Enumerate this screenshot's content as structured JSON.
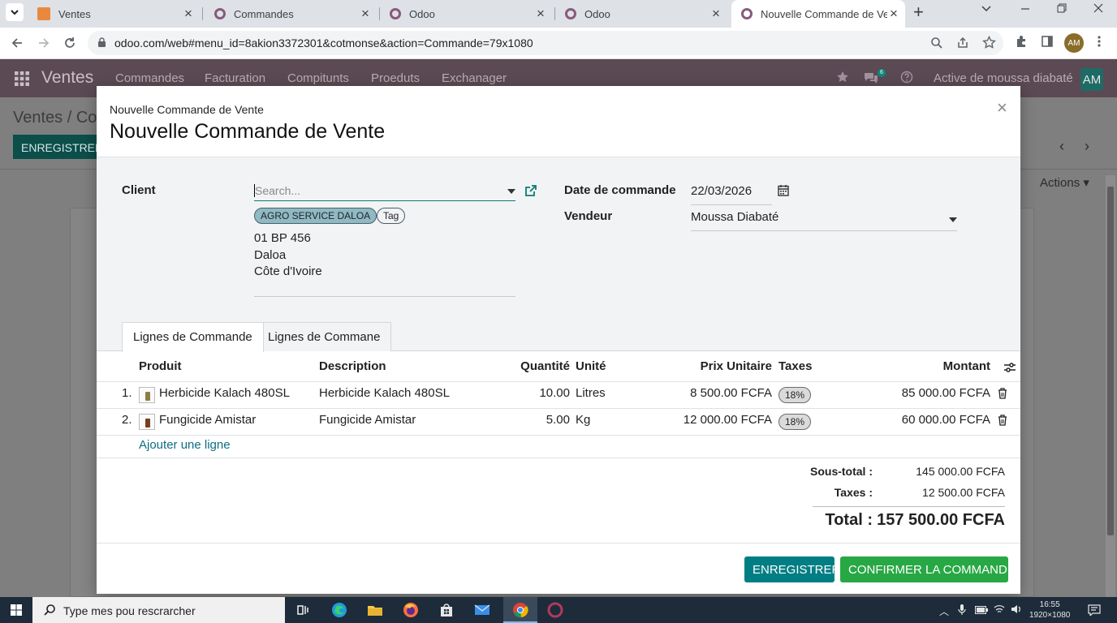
{
  "browser": {
    "tabs": [
      {
        "label": "Ventes",
        "icon": "ventes-favicon"
      },
      {
        "label": "Commandes",
        "icon": "odoo-favicon"
      },
      {
        "label": "Odoo",
        "icon": "odoo-favicon"
      },
      {
        "label": "Odoo",
        "icon": "odoo-favicon"
      },
      {
        "label": "Nouvelle Commande de Vente",
        "icon": "odoo-favicon",
        "active": true
      }
    ],
    "url": "odoo.com/web#menu_id=8akion3372301&cotmonse&action=Commande=79x1080",
    "profile_initials": "AM"
  },
  "navbar": {
    "app": "Ventes",
    "menus": [
      "Commandes",
      "Facturation",
      "Compitunts",
      "Proeduts",
      "Exchanager"
    ],
    "chat_count": "6",
    "company": "Active de moussa diabaté",
    "avatar": "AM"
  },
  "background_page": {
    "breadcrumb": "Ventes / Co",
    "save_label": "ENREGISTRER",
    "actions_label": "Actions"
  },
  "modal": {
    "subtitle": "Nouvelle Commande de Vente",
    "title": "Nouvelle Commande de Vente",
    "close": "×",
    "client": {
      "label": "Client",
      "placeholder": "Search...",
      "tags": [
        "AGRO SERVICE DALOA",
        "Tag"
      ],
      "address": [
        "01 BP 456",
        "Daloa",
        "Côte d'Ivoire"
      ]
    },
    "order_date": {
      "label": "Date de commande",
      "value": "22/03/2026"
    },
    "salesperson": {
      "label": "Vendeur",
      "value": "Moussa Diabaté"
    },
    "tabs": [
      "Lignes de Commande",
      "Lignes de Commane"
    ],
    "columns": {
      "product": "Produit",
      "description": "Description",
      "quantity": "Quantité",
      "unit": "Unité",
      "unit_price": "Prix Unitaire",
      "taxes": "Taxes",
      "amount": "Montant"
    },
    "lines": [
      {
        "num": "1.",
        "product": "Herbicide Kalach 480SL",
        "description": "Herbicide Kalach 480SL",
        "quantity": "10.00",
        "unit": "Litres",
        "unit_price": "8 500.00 FCFA",
        "tax": "18%",
        "amount": "85 000.00 FCFA"
      },
      {
        "num": "2.",
        "product": "Fungicide Amistar",
        "description": "Fungicide Amistar",
        "quantity": "5.00",
        "unit": "Kg",
        "unit_price": "12 000.00 FCFA",
        "tax": "18%",
        "amount": "60 000.00 FCFA"
      }
    ],
    "add_line": "Ajouter une ligne",
    "totals": {
      "subtotal_label": "Sous-total :",
      "subtotal": "145 000.00 FCFA",
      "taxes_label": "Taxes :",
      "taxes": "12 500.00 FCFA",
      "total_label": "Total :",
      "total": "157 500.00 FCFA"
    },
    "buttons": {
      "save": "ENREGISTRER",
      "confirm": "CONFIRMER LA COMMANDE"
    }
  },
  "taskbar": {
    "search_placeholder": "Type mes pou rescrarcher",
    "time": "16:55",
    "resolution": "1920×1080"
  },
  "colors": {
    "odoo_purple": "#714b67",
    "teal": "#017e84",
    "green": "#28a745",
    "link": "#0d6e80"
  }
}
